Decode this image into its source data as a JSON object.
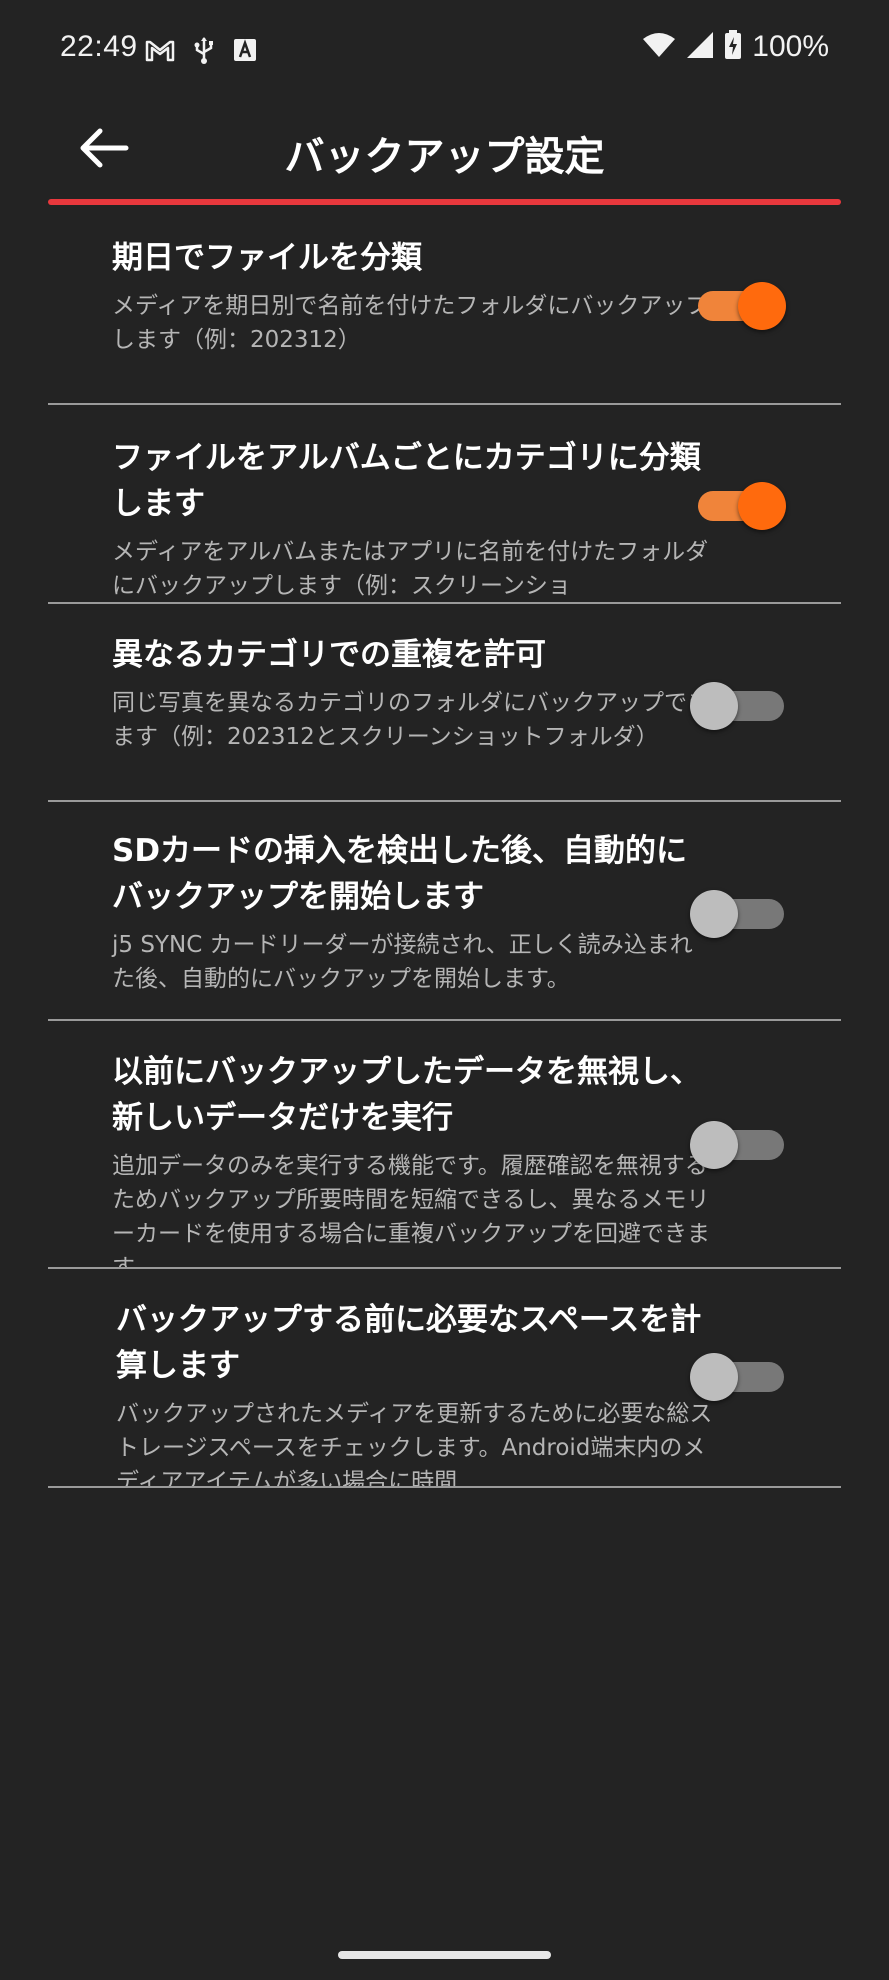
{
  "status_bar": {
    "time": "22:49",
    "battery": "100%",
    "left_icons": [
      "gmail-icon",
      "usb-icon",
      "font-app-icon"
    ],
    "right_icons": [
      "wifi-icon",
      "signal-icon",
      "battery-charging-icon"
    ]
  },
  "header": {
    "title": "バックアップ設定",
    "accent_color": "#e8383d"
  },
  "settings": [
    {
      "title": "期日でファイルを分類",
      "description": "メディアを期日別で名前を付けたフォルダにバックアップします（例：202312）",
      "enabled": true
    },
    {
      "title": "ファイルをアルバムごとにカテゴリに分類します",
      "description": "メディアをアルバムまたはアプリに名前を付けたフォルダにバックアップします（例：スクリーンショ",
      "enabled": true
    },
    {
      "title": "異なるカテゴリでの重複を許可",
      "description": "同じ写真を異なるカテゴリのフォルダにバックアップできます（例：202312とスクリーンショットフォルダ）",
      "enabled": false
    },
    {
      "title": "SDカードの挿入を検出した後、自動的にバックアップを開始します",
      "description": "j5 SYNC カードリーダーが接続され、正しく読み込まれた後、自動的にバックアップを開始します。",
      "enabled": false
    },
    {
      "title": "以前にバックアップしたデータを無視し、新しいデータだけを実行",
      "description": "追加データのみを実行する機能です。履歴確認を無視するためバックアップ所要時間を短縮できるし、異なるメモリーカードを使用する場合に重複バックアップを回避できます。",
      "enabled": false
    },
    {
      "title": "バックアップする前に必要なスペースを計算します",
      "description": "バックアップされたメディアを更新するために必要な総ストレージスペースをチェックします。Android端末内のメディアアイテムが多い場合に時間",
      "enabled": false
    }
  ],
  "colors": {
    "background": "#232323",
    "toggle_on_thumb": "#ff6a0d",
    "toggle_on_track": "#f0843a",
    "toggle_off_thumb": "#bdbdbd",
    "toggle_off_track": "#787878"
  }
}
